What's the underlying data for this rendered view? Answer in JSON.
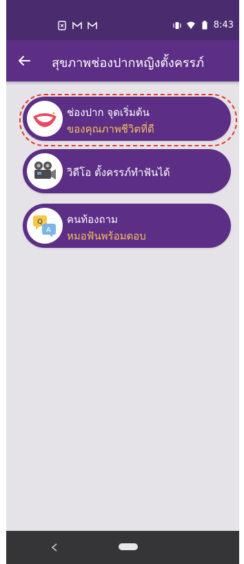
{
  "status_bar": {
    "time": "8:43",
    "left_icons": [
      "sim-alert-icon",
      "gmail-icon",
      "gmail-icon"
    ],
    "right_icons": [
      "vibrate-icon",
      "wifi-icon",
      "battery-icon"
    ]
  },
  "app_bar": {
    "title": "สุขภาพช่องปากหญิงตั้งครรภ์",
    "back_icon": "arrow-left-icon"
  },
  "menu": {
    "items": [
      {
        "line1": "ช่องปาก จุดเริ่มต้น",
        "line2": "ของคุณภาพชีวิตที่ดี",
        "icon": "mouth-smile-icon",
        "highlighted": true
      },
      {
        "line1": "วิดีโอ ตั้งครรภ์ทำฟันได้",
        "line2": "",
        "icon": "video-camera-icon",
        "highlighted": false
      },
      {
        "line1": "คนท้องถาม",
        "line2": "หมอฟันพร้อมตอบ",
        "icon": "qa-chat-icon",
        "highlighted": false
      }
    ]
  },
  "colors": {
    "status_bar": "#4a2c6e",
    "app_bar": "#5c2e86",
    "item_bg": "#5c2e86",
    "accent_text": "#f7c15a",
    "background": "#e6e3e8",
    "highlight_dash": "#e8331f"
  },
  "nav_bar": {
    "back_icon": "triangle-back-icon",
    "home_icon": "home-pill-icon"
  }
}
